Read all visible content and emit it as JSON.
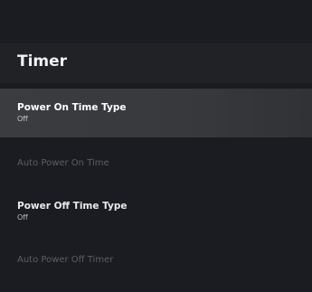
{
  "page": {
    "title": "Timer"
  },
  "menu": {
    "items": [
      {
        "label": "Power On Time Type",
        "value": "Off"
      },
      {
        "label": "Auto Power On Time"
      },
      {
        "label": "Power Off Time Type",
        "value": "Off"
      },
      {
        "label": "Auto Power Off Timer"
      }
    ]
  },
  "colors": {
    "background": "#1a1c21",
    "header": "#202226",
    "focus_highlight": "#3a3c40",
    "disabled_text": "#5b5e64"
  }
}
